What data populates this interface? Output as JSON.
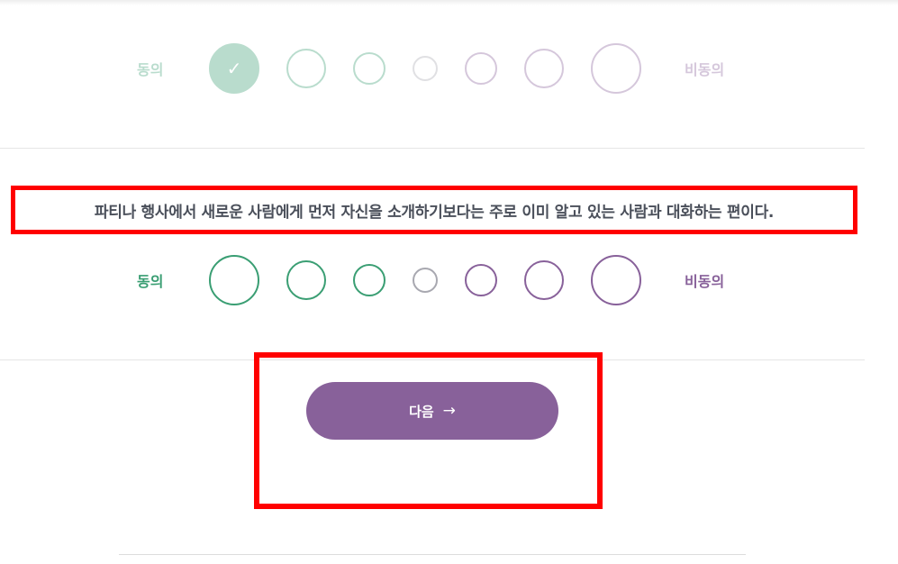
{
  "previous_question": {
    "agree_label": "동의",
    "disagree_label": "비동의",
    "selected_option": 1,
    "check_icon": "✓"
  },
  "current_question": {
    "text": "파티나 행사에서 새로운 사람에게 먼저 자신을 소개하기보다는 주로 이미 알고 있는 사람과 대화하는 편이다.",
    "agree_label": "동의",
    "disagree_label": "비동의",
    "selected_option": null
  },
  "next_button": {
    "label": "다음",
    "icon": "→"
  },
  "colors": {
    "agree": "#3a9e73",
    "neutral": "#a8a8b0",
    "disagree": "#88619a",
    "question_text": "#4a4f5a",
    "highlight": "#ff0000"
  }
}
